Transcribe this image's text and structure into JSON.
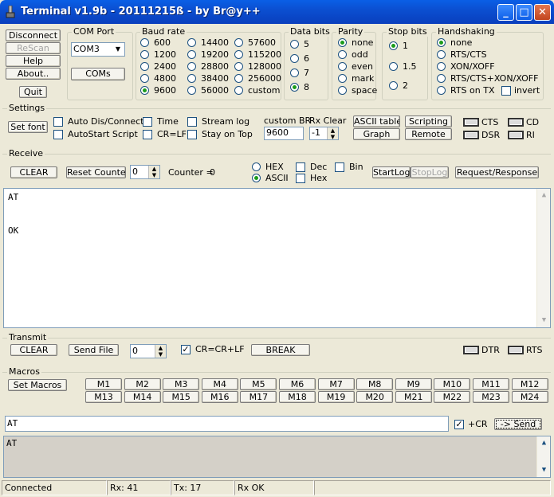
{
  "window": {
    "title": "Terminal v1.9b - 20111215ß - by Br@y++"
  },
  "left_buttons": {
    "disconnect": "Disconnect",
    "rescan": "ReScan",
    "help": "Help",
    "about": "About..",
    "quit": "Quit"
  },
  "com_port": {
    "label": "COM Port",
    "value": "COM3",
    "coms_button": "COMs"
  },
  "baud_rate": {
    "label": "Baud rate",
    "options": [
      "600",
      "1200",
      "2400",
      "4800",
      "9600",
      "14400",
      "19200",
      "28800",
      "38400",
      "56000",
      "57600",
      "115200",
      "128000",
      "256000",
      "custom"
    ],
    "selected": "9600"
  },
  "data_bits": {
    "label": "Data bits",
    "options": [
      "5",
      "6",
      "7",
      "8"
    ],
    "selected": "8"
  },
  "parity": {
    "label": "Parity",
    "options": [
      "none",
      "odd",
      "even",
      "mark",
      "space"
    ],
    "selected": "none"
  },
  "stop_bits": {
    "label": "Stop bits",
    "options": [
      "1",
      "1.5",
      "2"
    ],
    "selected": "1"
  },
  "handshaking": {
    "label": "Handshaking",
    "options": [
      "none",
      "RTS/CTS",
      "XON/XOFF",
      "RTS/CTS+XON/XOFF",
      "RTS on TX"
    ],
    "selected": "none",
    "invert_label": "invert"
  },
  "settings": {
    "label": "Settings",
    "set_font": "Set font",
    "auto_dis_connect": "Auto Dis/Connect",
    "autostart_script": "AutoStart Script",
    "time": "Time",
    "cr_lf": "CR=LF",
    "stream_log": "Stream log",
    "stay_on_top": "Stay on Top",
    "custom_br_label": "custom BR",
    "custom_br_value": "9600",
    "rx_clear_label": "Rx Clear",
    "rx_clear_value": "-1",
    "ascii_table": "ASCII table",
    "graph": "Graph",
    "scripting": "Scripting",
    "remote": "Remote",
    "cts": "CTS",
    "cd": "CD",
    "dsr": "DSR",
    "ri": "RI"
  },
  "receive": {
    "label": "Receive",
    "clear": "CLEAR",
    "reset_counter": "Reset Counter",
    "counter_spin": "0",
    "counter_label": "Counter =",
    "counter_value": "0",
    "hex": "HEX",
    "ascii": "ASCII",
    "mode_selected": "ASCII",
    "dec": "Dec",
    "hex_cb": "Hex",
    "bin": "Bin",
    "startlog": "StartLog",
    "stoplog": "StopLog",
    "request_response": "Request/Response",
    "lines": [
      "AT",
      "",
      "",
      "OK"
    ]
  },
  "transmit": {
    "label": "Transmit",
    "clear": "CLEAR",
    "send_file": "Send File",
    "spin": "0",
    "cr_crlf": "CR=CR+LF",
    "break": "BREAK",
    "dtr": "DTR",
    "rts": "RTS"
  },
  "macros": {
    "label": "Macros",
    "set_macros": "Set Macros",
    "row1": [
      "M1",
      "M2",
      "M3",
      "M4",
      "M5",
      "M6",
      "M7",
      "M8",
      "M9",
      "M10",
      "M11",
      "M12"
    ],
    "row2": [
      "M13",
      "M14",
      "M15",
      "M16",
      "M17",
      "M18",
      "M19",
      "M20",
      "M21",
      "M22",
      "M23",
      "M24"
    ]
  },
  "send": {
    "input_value": "AT",
    "plus_cr": "+CR",
    "send_button": "-> Send"
  },
  "transmit_log": {
    "lines": [
      "AT"
    ]
  },
  "status": {
    "connection": "Connected",
    "rx": "Rx: 41",
    "tx": "Tx: 17",
    "rx_status": "Rx OK"
  }
}
